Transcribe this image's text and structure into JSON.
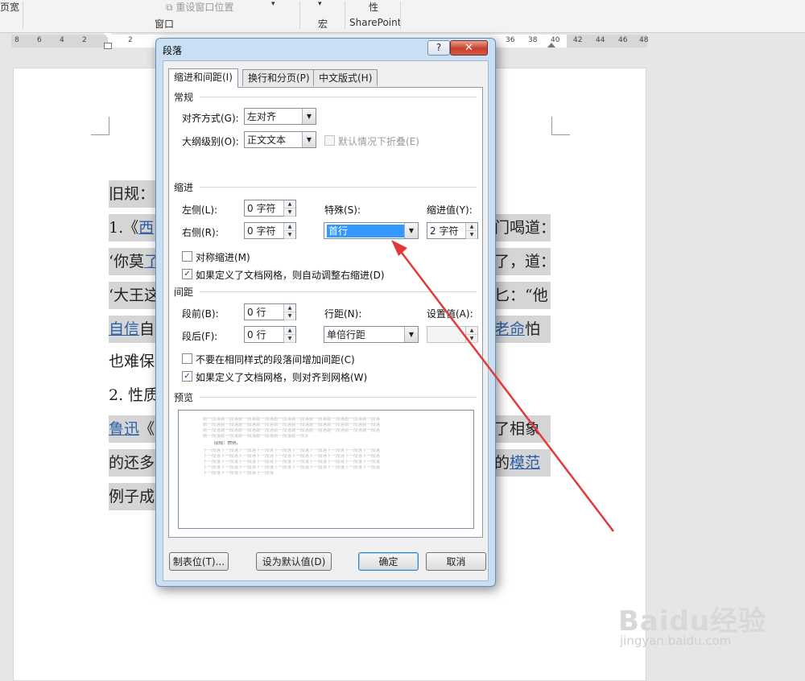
{
  "ribbon": {
    "page_width_label": "页宽",
    "reset_window_label": "重设窗口位置",
    "window_group_label": "窗口",
    "macro_group_label": "宏",
    "property_label": "性",
    "sharepoint_label": "SharePoint",
    "dropdown_glyph": "▾"
  },
  "ruler": {
    "left_numbers": [
      "8",
      "6",
      "4",
      "2",
      "2"
    ],
    "right_numbers": [
      "36",
      "38",
      "40",
      "42",
      "44",
      "46",
      "48"
    ]
  },
  "document": {
    "lines": [
      {
        "pre": "旧规：",
        "link": "",
        "post": ""
      },
      {
        "pre": "1.《",
        "link": "西",
        "post": "门喝道："
      },
      {
        "pre": "‘你莫",
        "link": "了",
        "post": "了，道："
      },
      {
        "pre": "‘大王这",
        "link": "",
        "post": "匕：“他"
      },
      {
        "pre": "",
        "link": "自信",
        "post": "自",
        "link2": "老命",
        "post2": "怕"
      },
      {
        "pre": "也难保",
        "link": "",
        "post": ""
      },
      {
        "pre": "2. 性质",
        "link": "",
        "post": ""
      },
      {
        "pre": "",
        "link": "鲁迅",
        "post": "《",
        "tail": "了相象"
      },
      {
        "pre": "的还多",
        "link": "",
        "post": "",
        "tail_pre": "的",
        "link2": "模范"
      },
      {
        "pre": "例子成",
        "link": "",
        "post": ""
      }
    ]
  },
  "dialog": {
    "title": "段落",
    "help_label": "?",
    "close_label": "✕",
    "tabs": [
      "缩进和间距(I)",
      "换行和分页(P)",
      "中文版式(H)"
    ],
    "general": {
      "section_label": "常规",
      "alignment_label": "对齐方式(G):",
      "alignment_value": "左对齐",
      "outline_label": "大纲级别(O):",
      "outline_value": "正文文本",
      "collapse_label": "默认情况下折叠(E)"
    },
    "indent": {
      "section_label": "缩进",
      "left_label": "左侧(L):",
      "left_value": "0 字符",
      "right_label": "右侧(R):",
      "right_value": "0 字符",
      "special_label": "特殊(S):",
      "special_value": "首行",
      "by_label": "缩进值(Y):",
      "by_value": "2 字符",
      "mirror_label": "对称缩进(M)",
      "auto_adjust_label": "如果定义了文档网格，则自动调整右缩进(D)"
    },
    "spacing": {
      "section_label": "间距",
      "before_label": "段前(B):",
      "before_value": "0 行",
      "after_label": "段后(F):",
      "after_value": "0 行",
      "line_spacing_label": "行距(N):",
      "line_spacing_value": "单倍行距",
      "at_label": "设置值(A):",
      "at_value": "",
      "no_space_label": "不要在相同样式的段落间增加间距(C)",
      "snap_grid_label": "如果定义了文档网格，则对齐到网格(W)"
    },
    "preview": {
      "section_label": "预览",
      "prev_line": "前一段落前一段落前一段落前一段落前一段落前一段落前一段落前一段落前一段落前一段落",
      "current_text": "旧规：惯例。",
      "next_line": "下一段落下一段落下一段落下一段落下一段落下一段落下一段落下一段落下一段落下一段落"
    },
    "buttons": {
      "tabs_label": "制表位(T)...",
      "default_label": "设为默认值(D)",
      "ok_label": "确定",
      "cancel_label": "取消"
    },
    "checkmark": "✓",
    "arrow_glyph": "▼",
    "spin_up": "▲",
    "spin_down": "▼"
  },
  "annotation": {
    "color": "#e23a3a"
  },
  "watermark": {
    "text": "Baidu经验",
    "url": "jingyan.baidu.com"
  }
}
